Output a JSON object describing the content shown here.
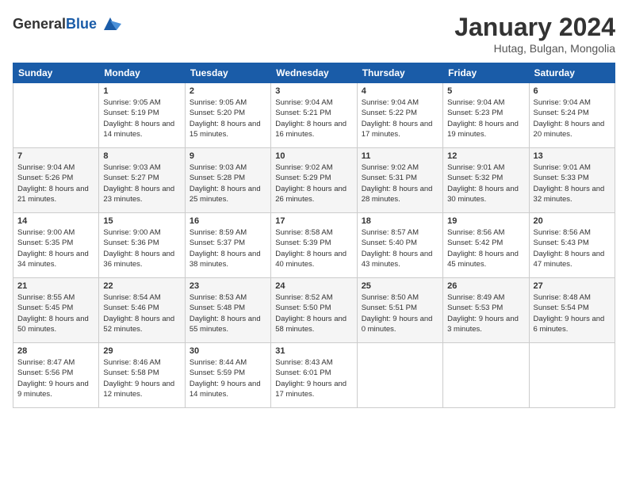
{
  "header": {
    "logo_general": "General",
    "logo_blue": "Blue",
    "title": "January 2024",
    "subtitle": "Hutag, Bulgan, Mongolia"
  },
  "weekdays": [
    "Sunday",
    "Monday",
    "Tuesday",
    "Wednesday",
    "Thursday",
    "Friday",
    "Saturday"
  ],
  "weeks": [
    [
      {
        "day": "",
        "sunrise": "",
        "sunset": "",
        "daylight": ""
      },
      {
        "day": "1",
        "sunrise": "Sunrise: 9:05 AM",
        "sunset": "Sunset: 5:19 PM",
        "daylight": "Daylight: 8 hours and 14 minutes."
      },
      {
        "day": "2",
        "sunrise": "Sunrise: 9:05 AM",
        "sunset": "Sunset: 5:20 PM",
        "daylight": "Daylight: 8 hours and 15 minutes."
      },
      {
        "day": "3",
        "sunrise": "Sunrise: 9:04 AM",
        "sunset": "Sunset: 5:21 PM",
        "daylight": "Daylight: 8 hours and 16 minutes."
      },
      {
        "day": "4",
        "sunrise": "Sunrise: 9:04 AM",
        "sunset": "Sunset: 5:22 PM",
        "daylight": "Daylight: 8 hours and 17 minutes."
      },
      {
        "day": "5",
        "sunrise": "Sunrise: 9:04 AM",
        "sunset": "Sunset: 5:23 PM",
        "daylight": "Daylight: 8 hours and 19 minutes."
      },
      {
        "day": "6",
        "sunrise": "Sunrise: 9:04 AM",
        "sunset": "Sunset: 5:24 PM",
        "daylight": "Daylight: 8 hours and 20 minutes."
      }
    ],
    [
      {
        "day": "7",
        "sunrise": "Sunrise: 9:04 AM",
        "sunset": "Sunset: 5:26 PM",
        "daylight": "Daylight: 8 hours and 21 minutes."
      },
      {
        "day": "8",
        "sunrise": "Sunrise: 9:03 AM",
        "sunset": "Sunset: 5:27 PM",
        "daylight": "Daylight: 8 hours and 23 minutes."
      },
      {
        "day": "9",
        "sunrise": "Sunrise: 9:03 AM",
        "sunset": "Sunset: 5:28 PM",
        "daylight": "Daylight: 8 hours and 25 minutes."
      },
      {
        "day": "10",
        "sunrise": "Sunrise: 9:02 AM",
        "sunset": "Sunset: 5:29 PM",
        "daylight": "Daylight: 8 hours and 26 minutes."
      },
      {
        "day": "11",
        "sunrise": "Sunrise: 9:02 AM",
        "sunset": "Sunset: 5:31 PM",
        "daylight": "Daylight: 8 hours and 28 minutes."
      },
      {
        "day": "12",
        "sunrise": "Sunrise: 9:01 AM",
        "sunset": "Sunset: 5:32 PM",
        "daylight": "Daylight: 8 hours and 30 minutes."
      },
      {
        "day": "13",
        "sunrise": "Sunrise: 9:01 AM",
        "sunset": "Sunset: 5:33 PM",
        "daylight": "Daylight: 8 hours and 32 minutes."
      }
    ],
    [
      {
        "day": "14",
        "sunrise": "Sunrise: 9:00 AM",
        "sunset": "Sunset: 5:35 PM",
        "daylight": "Daylight: 8 hours and 34 minutes."
      },
      {
        "day": "15",
        "sunrise": "Sunrise: 9:00 AM",
        "sunset": "Sunset: 5:36 PM",
        "daylight": "Daylight: 8 hours and 36 minutes."
      },
      {
        "day": "16",
        "sunrise": "Sunrise: 8:59 AM",
        "sunset": "Sunset: 5:37 PM",
        "daylight": "Daylight: 8 hours and 38 minutes."
      },
      {
        "day": "17",
        "sunrise": "Sunrise: 8:58 AM",
        "sunset": "Sunset: 5:39 PM",
        "daylight": "Daylight: 8 hours and 40 minutes."
      },
      {
        "day": "18",
        "sunrise": "Sunrise: 8:57 AM",
        "sunset": "Sunset: 5:40 PM",
        "daylight": "Daylight: 8 hours and 43 minutes."
      },
      {
        "day": "19",
        "sunrise": "Sunrise: 8:56 AM",
        "sunset": "Sunset: 5:42 PM",
        "daylight": "Daylight: 8 hours and 45 minutes."
      },
      {
        "day": "20",
        "sunrise": "Sunrise: 8:56 AM",
        "sunset": "Sunset: 5:43 PM",
        "daylight": "Daylight: 8 hours and 47 minutes."
      }
    ],
    [
      {
        "day": "21",
        "sunrise": "Sunrise: 8:55 AM",
        "sunset": "Sunset: 5:45 PM",
        "daylight": "Daylight: 8 hours and 50 minutes."
      },
      {
        "day": "22",
        "sunrise": "Sunrise: 8:54 AM",
        "sunset": "Sunset: 5:46 PM",
        "daylight": "Daylight: 8 hours and 52 minutes."
      },
      {
        "day": "23",
        "sunrise": "Sunrise: 8:53 AM",
        "sunset": "Sunset: 5:48 PM",
        "daylight": "Daylight: 8 hours and 55 minutes."
      },
      {
        "day": "24",
        "sunrise": "Sunrise: 8:52 AM",
        "sunset": "Sunset: 5:50 PM",
        "daylight": "Daylight: 8 hours and 58 minutes."
      },
      {
        "day": "25",
        "sunrise": "Sunrise: 8:50 AM",
        "sunset": "Sunset: 5:51 PM",
        "daylight": "Daylight: 9 hours and 0 minutes."
      },
      {
        "day": "26",
        "sunrise": "Sunrise: 8:49 AM",
        "sunset": "Sunset: 5:53 PM",
        "daylight": "Daylight: 9 hours and 3 minutes."
      },
      {
        "day": "27",
        "sunrise": "Sunrise: 8:48 AM",
        "sunset": "Sunset: 5:54 PM",
        "daylight": "Daylight: 9 hours and 6 minutes."
      }
    ],
    [
      {
        "day": "28",
        "sunrise": "Sunrise: 8:47 AM",
        "sunset": "Sunset: 5:56 PM",
        "daylight": "Daylight: 9 hours and 9 minutes."
      },
      {
        "day": "29",
        "sunrise": "Sunrise: 8:46 AM",
        "sunset": "Sunset: 5:58 PM",
        "daylight": "Daylight: 9 hours and 12 minutes."
      },
      {
        "day": "30",
        "sunrise": "Sunrise: 8:44 AM",
        "sunset": "Sunset: 5:59 PM",
        "daylight": "Daylight: 9 hours and 14 minutes."
      },
      {
        "day": "31",
        "sunrise": "Sunrise: 8:43 AM",
        "sunset": "Sunset: 6:01 PM",
        "daylight": "Daylight: 9 hours and 17 minutes."
      },
      {
        "day": "",
        "sunrise": "",
        "sunset": "",
        "daylight": ""
      },
      {
        "day": "",
        "sunrise": "",
        "sunset": "",
        "daylight": ""
      },
      {
        "day": "",
        "sunrise": "",
        "sunset": "",
        "daylight": ""
      }
    ]
  ]
}
